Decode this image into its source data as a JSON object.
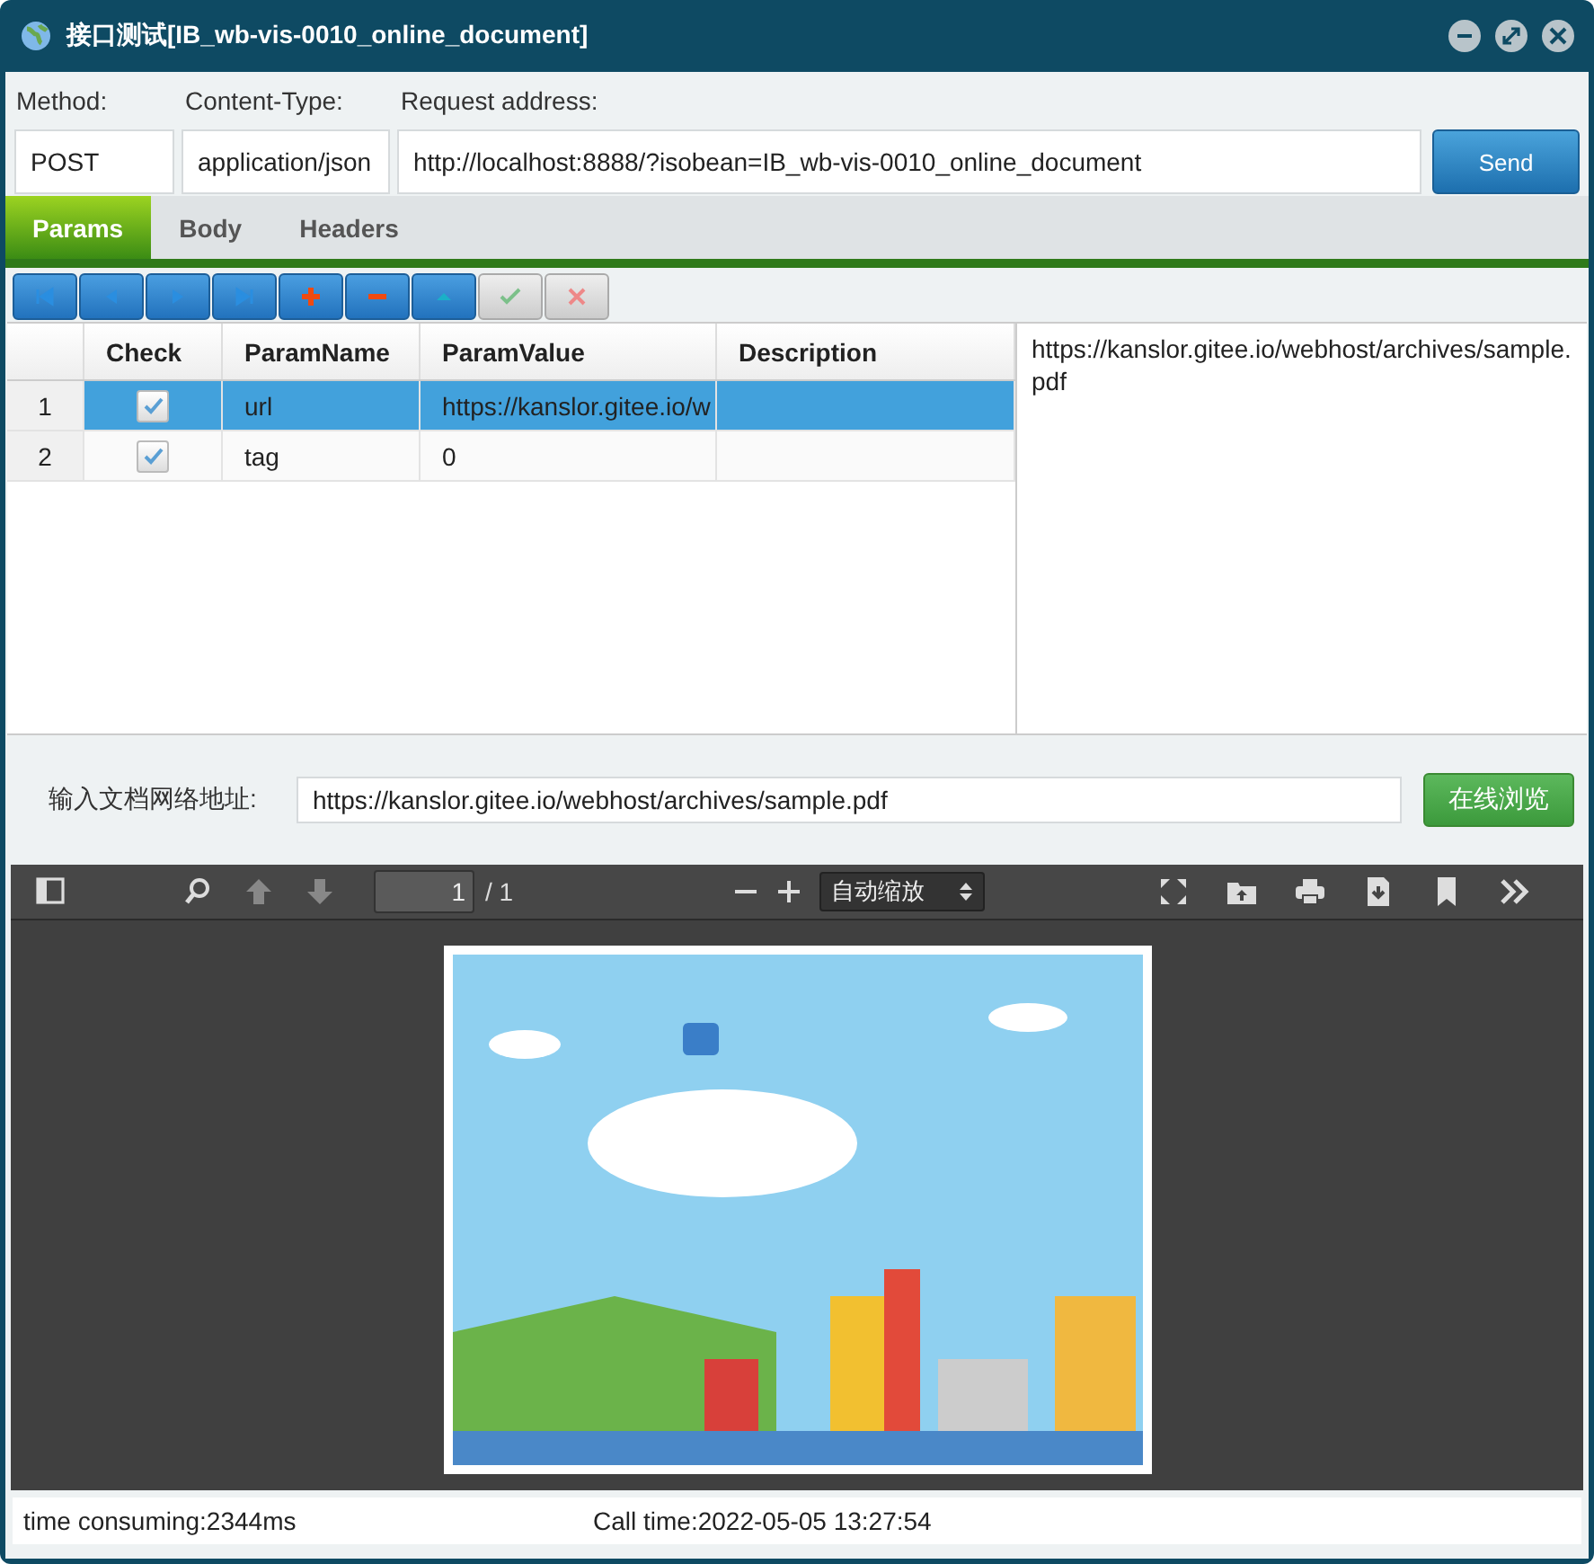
{
  "window": {
    "title": "接口测试[IB_wb-vis-0010_online_document]"
  },
  "request": {
    "method_label": "Method:",
    "content_type_label": "Content-Type:",
    "address_label": "Request address:",
    "method": "POST",
    "content_type": "application/json",
    "address": "http://localhost:8888/?isobean=IB_wb-vis-0010_online_document",
    "send": "Send"
  },
  "tabs": [
    {
      "label": "Params",
      "selected": true
    },
    {
      "label": "Body",
      "selected": false
    },
    {
      "label": "Headers",
      "selected": false
    }
  ],
  "toolbar": [
    {
      "kind": "first",
      "disabled": false
    },
    {
      "kind": "prev",
      "disabled": false
    },
    {
      "kind": "next",
      "disabled": false
    },
    {
      "kind": "last",
      "disabled": false
    },
    {
      "kind": "add",
      "disabled": false
    },
    {
      "kind": "remove",
      "disabled": false
    },
    {
      "kind": "up",
      "disabled": false
    },
    {
      "kind": "accept",
      "disabled": true
    },
    {
      "kind": "cancel",
      "disabled": true
    }
  ],
  "table": {
    "columns": [
      "Check",
      "ParamName",
      "ParamValue",
      "Description"
    ],
    "rows": [
      {
        "index": "1",
        "checked": true,
        "name": "url",
        "value": "https://kanslor.gitee.io/w",
        "selected": true
      },
      {
        "index": "2",
        "checked": true,
        "name": "tag",
        "value": "0",
        "selected": false
      }
    ]
  },
  "detail_text": "https://kanslor.gitee.io/webhost/archives/sample.pdf",
  "document": {
    "label": "输入文档网络地址:",
    "url": "https://kanslor.gitee.io/webhost/archives/sample.pdf",
    "button": "在线浏览"
  },
  "viewer": {
    "page": "1",
    "page_count": "/ 1",
    "zoom": "自动缩放",
    "left_tools": [
      {
        "kind": "sidebar",
        "disabled": false
      },
      {
        "kind": "search",
        "disabled": false
      },
      {
        "kind": "up",
        "disabled": true
      },
      {
        "kind": "down",
        "disabled": true
      }
    ],
    "right_tools": [
      {
        "kind": "fullscreen",
        "disabled": false
      },
      {
        "kind": "open",
        "disabled": false
      },
      {
        "kind": "print",
        "disabled": false
      },
      {
        "kind": "download",
        "disabled": false
      },
      {
        "kind": "bookmark",
        "disabled": false
      },
      {
        "kind": "more",
        "disabled": false
      }
    ]
  },
  "status_bar": {
    "elapsed": "time consuming:2344ms",
    "call_time": "Call time:2022-05-05 13:27:54"
  }
}
